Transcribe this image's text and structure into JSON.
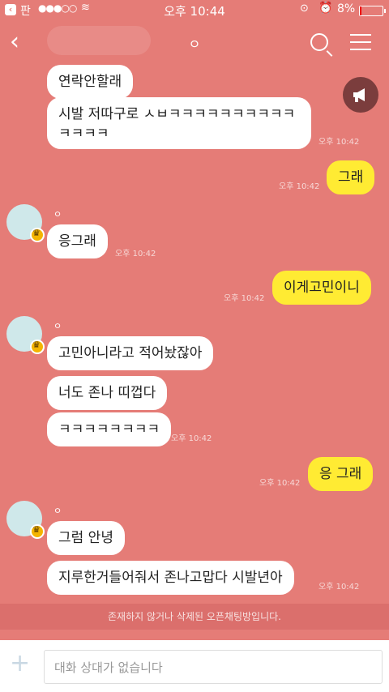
{
  "status": {
    "carrier": "판",
    "time": "오후 10:44",
    "battery": "8%"
  },
  "header": {
    "title": "ㅇ"
  },
  "messages": [
    {
      "text": "연락안할래",
      "side": "left"
    },
    {
      "text": "시발 저따구로 ㅅㅂㅋㅋㅋㅋㅋㅋㅋㅋㅋㅋ",
      "text2": "ㅋㅋㅋㅋ",
      "side": "left",
      "time": "오후 10:42"
    },
    {
      "text": "그래",
      "side": "right",
      "time": "오후 10:42"
    },
    {
      "sender": "ㅇ",
      "text": "응그래",
      "side": "left",
      "time": "오후 10:42"
    },
    {
      "text": "이게고민이니",
      "side": "right",
      "time": "오후 10:42"
    },
    {
      "sender": "ㅇ",
      "text": "고민아니라고 적어놨잖아",
      "side": "left"
    },
    {
      "text": "너도 존나 띠껍다",
      "side": "left"
    },
    {
      "text": "ㅋㅋㅋㅋㅋㅋㅋㅋ",
      "side": "left",
      "time": "오후 10:42"
    },
    {
      "text": "응 그래",
      "side": "right",
      "time": "오후 10:42"
    },
    {
      "sender": "ㅇ",
      "text": "그럼 안녕",
      "side": "left"
    },
    {
      "text": "지루한거들어줘서 존나고맙다 시발년아",
      "side": "left",
      "time": "오후 10:42"
    }
  ],
  "system_notice": "존재하지 않거나 삭제된 오픈채팅방입니다.",
  "input": {
    "placeholder": "대화 상대가 없습니다"
  },
  "colors": {
    "background": "#E57C77",
    "my_bubble": "#FFEB33",
    "their_bubble": "#FFFFFF"
  }
}
